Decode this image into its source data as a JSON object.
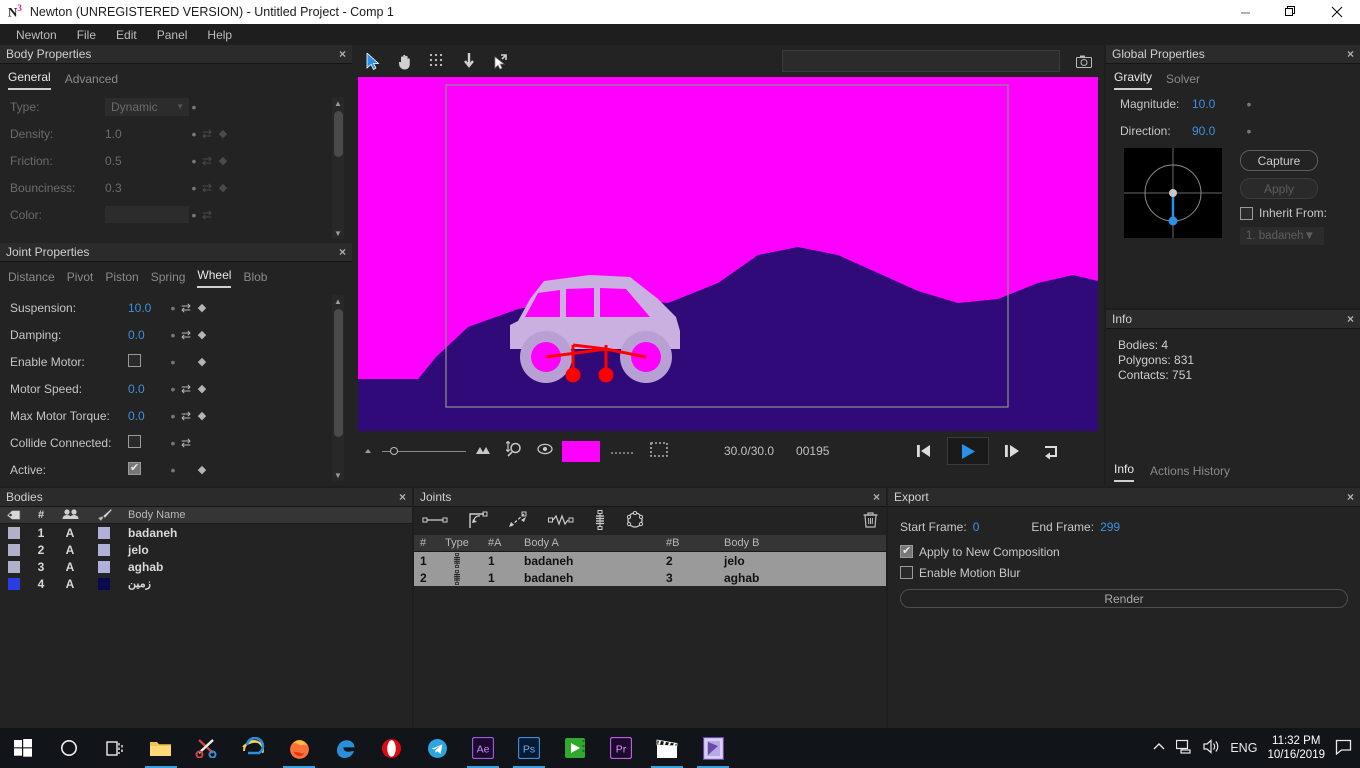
{
  "titlebar": {
    "logo": "N",
    "logo_sup": "3",
    "title": "Newton (UNREGISTERED VERSION) - Untitled Project - Comp 1",
    "minimize": "minimize-icon",
    "maximize": "restore-icon",
    "close": "close-icon"
  },
  "menubar": {
    "items": [
      "Newton",
      "File",
      "Edit",
      "Panel",
      "Help"
    ]
  },
  "body_properties": {
    "title": "Body Properties",
    "close": "×",
    "tabs": [
      {
        "label": "General",
        "active": true
      },
      {
        "label": "Advanced",
        "active": false
      }
    ],
    "rows": [
      {
        "label": "Type:",
        "value": "Dynamic",
        "kind": "select",
        "dot": "•",
        "shuffle": false,
        "diamond": false
      },
      {
        "label": "Density:",
        "value": "1.0",
        "kind": "number",
        "dot": "•",
        "shuffle": true,
        "diamond": true
      },
      {
        "label": "Friction:",
        "value": "0.5",
        "kind": "number",
        "dot": "•",
        "shuffle": true,
        "diamond": true
      },
      {
        "label": "Bounciness:",
        "value": "0.3",
        "kind": "number",
        "dot": "•",
        "shuffle": true,
        "diamond": true
      },
      {
        "label": "Color:",
        "value": "",
        "kind": "color",
        "dot": "•",
        "shuffle": true,
        "diamond": false
      }
    ]
  },
  "joint_properties": {
    "title": "Joint Properties",
    "close": "×",
    "tabs": [
      {
        "label": "Distance",
        "active": false
      },
      {
        "label": "Pivot",
        "active": false
      },
      {
        "label": "Piston",
        "active": false
      },
      {
        "label": "Spring",
        "active": false
      },
      {
        "label": "Wheel",
        "active": true
      },
      {
        "label": "Blob",
        "active": false
      }
    ],
    "rows": [
      {
        "label": "Suspension:",
        "value": "10.0",
        "kind": "number",
        "shuffle": true,
        "diamond": true
      },
      {
        "label": "Damping:",
        "value": "0.0",
        "kind": "number",
        "shuffle": true,
        "diamond": true
      },
      {
        "label": "Enable Motor:",
        "value": "",
        "kind": "checkbox",
        "checked": false,
        "shuffle": false,
        "diamond": true
      },
      {
        "label": "Motor Speed:",
        "value": "0.0",
        "kind": "number",
        "shuffle": true,
        "diamond": true
      },
      {
        "label": "Max Motor Torque:",
        "value": "0.0",
        "kind": "number",
        "shuffle": true,
        "diamond": true
      },
      {
        "label": "Collide Connected:",
        "value": "",
        "kind": "checkbox",
        "checked": false,
        "shuffle": true,
        "diamond": false
      },
      {
        "label": "Active:",
        "value": "",
        "kind": "checkbox",
        "checked": true,
        "shuffle": false,
        "diamond": true
      }
    ]
  },
  "viewport": {
    "tools": [
      {
        "name": "select-arrow-tool",
        "active": true
      },
      {
        "name": "pan-hand-tool",
        "active": false
      },
      {
        "name": "grid-tool",
        "active": false
      },
      {
        "name": "gravity-arrow-tool",
        "active": false
      },
      {
        "name": "pointer-drag-tool",
        "active": false
      }
    ],
    "search_value": "",
    "search_placeholder": "",
    "camera_icon": "camera-icon",
    "scene": {
      "background_color": "#ff00ff",
      "terrain_color": "#300a78",
      "car_body_color": "#c8a8e0",
      "joint_color": "#ff0000",
      "frame_border_color": "#8a8a8a"
    },
    "bottom": {
      "zoom_min_icon": "zoom-out-icon",
      "zoom_max_icon": "zoom-in-icon",
      "fit_icon": "fit-to-view-icon",
      "visibility_icon": "eye-icon",
      "color_swatch": "#ff00ff",
      "dotted_line_icon": "dashed-line-icon",
      "marquee_icon": "selection-box-icon",
      "fps": "30.0/30.0",
      "frame_counter": "00195",
      "btn_first_frame": "skip-to-start-icon",
      "btn_play": "play-icon",
      "btn_step": "step-forward-icon",
      "btn_loop": "loop-icon"
    }
  },
  "global_properties": {
    "title": "Global Properties",
    "close": "×",
    "tabs": [
      {
        "label": "Gravity",
        "active": true
      },
      {
        "label": "Solver",
        "active": false
      }
    ],
    "magnitude_label": "Magnitude:",
    "magnitude_value": "10.0",
    "direction_label": "Direction:",
    "direction_value": "90.0",
    "capture_label": "Capture",
    "apply_label": "Apply",
    "inherit_label": "Inherit From:",
    "inherit_checked": false,
    "inherit_value": "1. badaneh"
  },
  "info": {
    "title": "Info",
    "close": "×",
    "lines": [
      "Bodies: 4",
      "Polygons: 831",
      "Contacts: 751"
    ],
    "tabs": [
      {
        "label": "Info",
        "active": true
      },
      {
        "label": "Actions History",
        "active": false
      }
    ]
  },
  "bodies": {
    "title": "Bodies",
    "close": "×",
    "columns": [
      "tag-icon",
      "#",
      "group-icon",
      "brush-icon",
      "Body Name"
    ],
    "column_name_header": "Body Name",
    "column_num_header": "#",
    "rows": [
      {
        "swatch": "#b0b0c8",
        "num": "1",
        "group": "A",
        "color": "#b0b0d8",
        "name": "badaneh"
      },
      {
        "swatch": "#b0b0c8",
        "num": "2",
        "group": "A",
        "color": "#b0b0d8",
        "name": "jelo"
      },
      {
        "swatch": "#b0b0c8",
        "num": "3",
        "group": "A",
        "color": "#b0b0d8",
        "name": "aghab"
      },
      {
        "swatch": "#2b3ce0",
        "num": "4",
        "group": "A",
        "color": "#0b0a50",
        "name": "زمین"
      }
    ]
  },
  "joints": {
    "title": "Joints",
    "close": "×",
    "toolbar_icons": [
      "distance-joint-icon",
      "pivot-joint-icon",
      "piston-joint-icon",
      "spring-joint-icon",
      "wheel-joint-icon",
      "blob-joint-icon"
    ],
    "delete_icon": "trash-icon",
    "columns": [
      "#",
      "Type",
      "#A",
      "Body A",
      "#B",
      "Body B"
    ],
    "rows": [
      {
        "num": "1",
        "type": "wheel-joint-icon",
        "a_num": "1",
        "a_name": "badaneh",
        "b_num": "2",
        "b_name": "jelo"
      },
      {
        "num": "2",
        "type": "wheel-joint-icon",
        "a_num": "1",
        "a_name": "badaneh",
        "b_num": "3",
        "b_name": "aghab"
      }
    ]
  },
  "export": {
    "title": "Export",
    "close": "×",
    "start_frame_label": "Start Frame:",
    "start_frame_value": "0",
    "end_frame_label": "End Frame:",
    "end_frame_value": "299",
    "apply_comp_label": "Apply to New Composition",
    "apply_comp_checked": true,
    "motion_blur_label": "Enable Motion Blur",
    "motion_blur_checked": false,
    "render_label": "Render"
  },
  "taskbar": {
    "items": [
      {
        "name": "start-button",
        "label": "windows-icon",
        "active": false
      },
      {
        "name": "cortana-search",
        "label": "circle-icon",
        "active": false
      },
      {
        "name": "task-view",
        "label": "task-view-icon",
        "active": false
      },
      {
        "name": "file-explorer",
        "label": "folder-icon",
        "active": true
      },
      {
        "name": "snipping-tool",
        "label": "scissors-icon",
        "active": false
      },
      {
        "name": "internet-explorer",
        "label": "ie-icon",
        "active": false
      },
      {
        "name": "firefox",
        "label": "firefox-icon",
        "active": true
      },
      {
        "name": "microsoft-edge",
        "label": "edge-icon",
        "active": false
      },
      {
        "name": "opera",
        "label": "opera-icon",
        "active": false
      },
      {
        "name": "telegram",
        "label": "telegram-icon",
        "active": false
      },
      {
        "name": "after-effects",
        "label": "Ae",
        "active": true
      },
      {
        "name": "photoshop",
        "label": "Ps",
        "active": true
      },
      {
        "name": "camtasia",
        "label": "camtasia-icon",
        "active": false
      },
      {
        "name": "premiere-pro",
        "label": "Pr",
        "active": false
      },
      {
        "name": "movie-maker",
        "label": "clapperboard-icon",
        "active": true
      },
      {
        "name": "newton-app",
        "label": "newton-icon",
        "active": true
      }
    ],
    "tray": {
      "chevron": "show-hidden-icons",
      "network": "network-icon",
      "volume": "volume-icon",
      "language": "ENG",
      "time": "11:32 PM",
      "date": "10/16/2019",
      "notifications": "action-center-icon"
    }
  }
}
